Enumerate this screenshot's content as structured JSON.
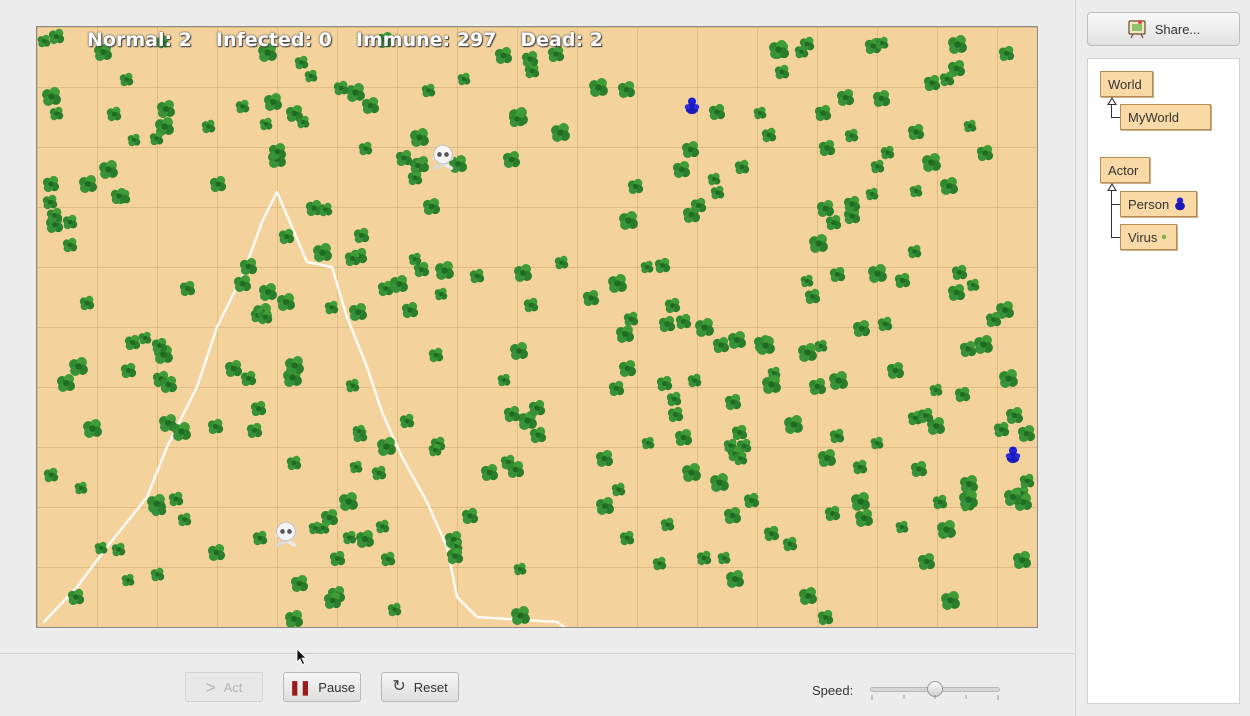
{
  "world": {
    "stats": {
      "normal": "Normal: 2",
      "infected": "Infected: 0",
      "immune": "Immune: 297",
      "dead": "Dead: 2"
    },
    "colors": {
      "sand": "#f3d29c",
      "grid": "#c8a56c",
      "tree": "#2f8a2f",
      "person": "#1f1fd6",
      "path": "#ffffff"
    },
    "actors": {
      "normal_person_icons": 2,
      "dead_skull_icons": 2,
      "tree_icons": "green-tree-icon"
    }
  },
  "controls": {
    "act_label": "Act",
    "pause_label": "Pause",
    "reset_label": "Reset",
    "speed_label": "Speed:",
    "speed_value": 0.5
  },
  "sidebar": {
    "share_label": "Share...",
    "classes": {
      "world": "World",
      "my_world": "MyWorld",
      "actor": "Actor",
      "person": "Person",
      "virus": "Virus"
    }
  }
}
